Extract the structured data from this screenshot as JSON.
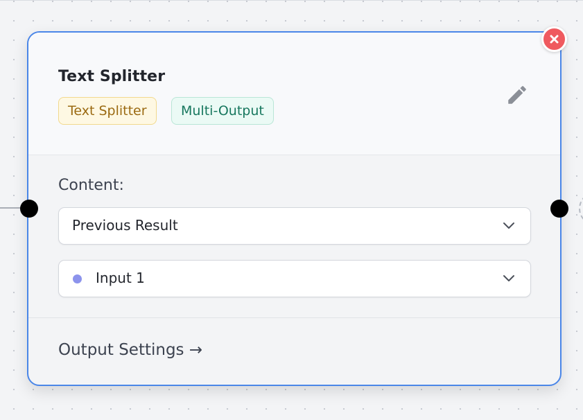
{
  "node": {
    "title": "Text Splitter",
    "badges": [
      {
        "label": "Text Splitter"
      },
      {
        "label": "Multi-Output"
      }
    ],
    "content_label": "Content:",
    "content_select": {
      "value": "Previous Result"
    },
    "input_select": {
      "value": "Input 1"
    },
    "output_settings_link": "Output Settings →"
  },
  "icons": {
    "edit": "pencil-icon",
    "close": "close-icon",
    "chevron": "chevron-down-icon"
  },
  "colors": {
    "node_border": "#4a86e8",
    "close_button": "#ef5a5f",
    "input_dot": "#8c93ec",
    "badge_type_text": "#9b6a12",
    "badge_multi_text": "#17775e"
  }
}
